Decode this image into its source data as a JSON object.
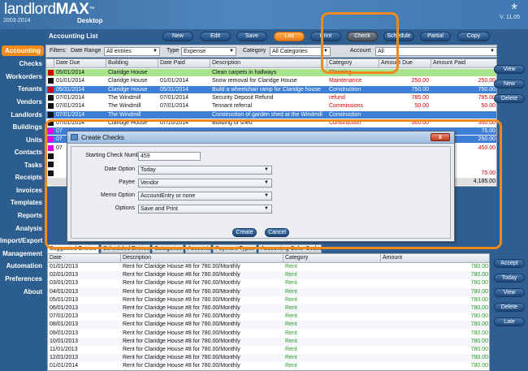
{
  "app": {
    "logo_main": "landlord",
    "logo_bold": "MAX",
    "logo_tm": "™",
    "logo_sub": "2003-2014",
    "logo_desktop": "Desktop",
    "version": "V. 11.05",
    "asterisk": "*"
  },
  "sidebar": {
    "items": [
      {
        "label": "Accounting"
      },
      {
        "label": "Checks"
      },
      {
        "label": "Workorders"
      },
      {
        "label": "Tenants"
      },
      {
        "label": "Vendors"
      },
      {
        "label": "Landlords"
      },
      {
        "label": "Buildings"
      },
      {
        "label": "Units"
      },
      {
        "label": "Contacts"
      },
      {
        "label": "Tasks"
      },
      {
        "label": "Receipts"
      },
      {
        "label": "Invoices"
      },
      {
        "label": "Templates"
      },
      {
        "label": "Reports"
      },
      {
        "label": "Analysis"
      },
      {
        "label": "Import/Export"
      },
      {
        "label": "Management"
      },
      {
        "label": "Automation"
      },
      {
        "label": "Preferences"
      },
      {
        "label": "About"
      }
    ]
  },
  "toolbar": {
    "section_title": "Accounting List",
    "buttons": [
      {
        "label": "New"
      },
      {
        "label": "Edit"
      },
      {
        "label": "Save"
      },
      {
        "label": "List"
      },
      {
        "label": "Print"
      },
      {
        "label": "Check"
      },
      {
        "label": "Schedule"
      },
      {
        "label": "Partial"
      },
      {
        "label": "Copy"
      }
    ]
  },
  "filters": {
    "filters_label": "Filters:",
    "date_range_label": "Date Range",
    "date_range_value": "All entries",
    "type_label": "Type",
    "type_value": "Expense",
    "category_label": "Category",
    "category_value": "All Categories",
    "account_label": "Account",
    "account_value": "All"
  },
  "table": {
    "headers": [
      "Date Due",
      "Building",
      "Date Paid",
      "Description",
      "Category",
      "Amount Due",
      "Amount Paid"
    ],
    "rows": [
      {
        "due": "05/01/2014",
        "building": "Claridge House",
        "paid": "",
        "desc": "Clean carpets in hallways",
        "cat": "Cleaning",
        "amt_due": "",
        "amt_paid": "",
        "swatch": "#d40000",
        "bg": "#a9e48d",
        "cat_color": "#d40000"
      },
      {
        "due": "01/01/2014",
        "building": "Claridge House",
        "paid": "01/01/2014",
        "desc": "Snow removal for Claridge House",
        "cat": "Maintenance",
        "amt_due": "250.00",
        "amt_paid": "250.00",
        "swatch": "#111111",
        "bg": "#ffffff",
        "cat_color": "#d40000"
      },
      {
        "due": "05/31/2014",
        "building": "Claridge House",
        "paid": "05/31/2014",
        "desc": "Build a wheelchair ramp for Claridge house",
        "cat": "Construction",
        "amt_due": "750.00",
        "amt_paid": "750.00",
        "swatch": "#d40000",
        "bg": "#3d7fd6",
        "cat_color": "#ffffff",
        "selected": true
      },
      {
        "due": "07/01/2014",
        "building": "The Windmill",
        "paid": "07/01/2014",
        "desc": "Security Deposit Refund",
        "cat": "refund",
        "amt_due": "785.00",
        "amt_paid": "785.00",
        "swatch": "#111111",
        "bg": "#ffffff",
        "cat_color": "#d40000"
      },
      {
        "due": "07/01/2014",
        "building": "The Windmill",
        "paid": "07/01/2014",
        "desc": "Tennant referral",
        "cat": "Commissions",
        "amt_due": "50.00",
        "amt_paid": "50.00",
        "swatch": "#111111",
        "bg": "#ffffff",
        "cat_color": "#d40000"
      },
      {
        "due": "07/01/2014",
        "building": "The Windmill",
        "paid": "",
        "desc": "Construction of garden shed at the Windmill",
        "cat": "Construction",
        "amt_due": "",
        "amt_paid": "",
        "swatch": "#111111",
        "bg": "#3d7fd6",
        "cat_color": "#ffffff",
        "selected": true
      },
      {
        "due": "07/01/2014",
        "building": "Claridge House",
        "paid": "07/10/2014",
        "desc": "Building of shed",
        "cat": "Construction",
        "amt_due": "500.00",
        "amt_paid": "500.00",
        "swatch": "#111111",
        "bg": "#ffffff",
        "cat_color": "#d40000"
      },
      {
        "due": "07",
        "building": "",
        "paid": "",
        "desc": "",
        "cat": "",
        "amt_due": "",
        "amt_paid": "75.00",
        "swatch": "#e000e0",
        "bg": "#3d7fd6",
        "cat_color": "#ffffff",
        "selected": true
      },
      {
        "due": "07",
        "building": "",
        "paid": "",
        "desc": "",
        "cat": "",
        "amt_due": "",
        "amt_paid": "250.00",
        "swatch": "#e000e0",
        "bg": "#3d7fd6",
        "cat_color": "#ffffff",
        "selected": true
      },
      {
        "due": "07",
        "building": "",
        "paid": "",
        "desc": "",
        "cat": "",
        "amt_due": "",
        "amt_paid": "450.00",
        "swatch": "#e000e0",
        "bg": "#ffffff",
        "cat_color": "#d40000"
      },
      {
        "due": "",
        "building": "",
        "paid": "",
        "desc": "",
        "cat": "",
        "amt_due": "",
        "amt_paid": "",
        "swatch": "#111111",
        "bg": "#ffffff",
        "cat_color": "#d40000"
      },
      {
        "due": "",
        "building": "",
        "paid": "",
        "desc": "",
        "cat": "",
        "amt_due": "",
        "amt_paid": "",
        "swatch": "#111111",
        "bg": "#ffffff",
        "cat_color": "#d40000"
      },
      {
        "due": "",
        "building": "",
        "paid": "",
        "desc": "",
        "cat": "",
        "amt_due": "",
        "amt_paid": "75.00",
        "swatch": "#111111",
        "bg": "#ffffff",
        "cat_color": "#d40000"
      },
      {
        "due": "",
        "building": "",
        "paid": "",
        "desc": "",
        "cat": "",
        "amt_due": "",
        "amt_paid": "4,185.00",
        "swatch": "",
        "bg": "#e0e0e0",
        "cat_color": "#111111",
        "total": true
      }
    ]
  },
  "right_buttons_top": [
    {
      "label": "View"
    },
    {
      "label": "New"
    },
    {
      "label": "Delete"
    }
  ],
  "right_buttons_bottom": [
    {
      "label": "Accept"
    },
    {
      "label": "Today"
    },
    {
      "label": "View"
    },
    {
      "label": "Delete"
    },
    {
      "label": "Late"
    }
  ],
  "bottom_tabs": [
    {
      "label": "Suggested Entries"
    },
    {
      "label": "Scheduled Entries"
    },
    {
      "label": "Categories"
    },
    {
      "label": "Accounts"
    },
    {
      "label": "Payment Types"
    },
    {
      "label": "Accounting Color Codes"
    }
  ],
  "bottom_table": {
    "headers": [
      "Date",
      "Description",
      "Category",
      "Amount"
    ],
    "rows": [
      {
        "date": "01/01/2013",
        "desc": "Rent for Claridge House #8 for 780.00/Monthly",
        "cat": "Rent",
        "amt": "780.00"
      },
      {
        "date": "02/01/2013",
        "desc": "Rent for Claridge House #8 for 780.00/Monthly",
        "cat": "Rent",
        "amt": "780.00"
      },
      {
        "date": "03/01/2013",
        "desc": "Rent for Claridge House #8 for 780.00/Monthly",
        "cat": "Rent",
        "amt": "780.00"
      },
      {
        "date": "04/01/2013",
        "desc": "Rent for Claridge House #8 for 780.00/Monthly",
        "cat": "Rent",
        "amt": "780.00"
      },
      {
        "date": "05/01/2013",
        "desc": "Rent for Claridge House #8 for 780.00/Monthly",
        "cat": "Rent",
        "amt": "780.00"
      },
      {
        "date": "06/01/2013",
        "desc": "Rent for Claridge House #8 for 780.00/Monthly",
        "cat": "Rent",
        "amt": "780.00"
      },
      {
        "date": "07/01/2013",
        "desc": "Rent for Claridge House #8 for 780.00/Monthly",
        "cat": "Rent",
        "amt": "780.00"
      },
      {
        "date": "08/01/2013",
        "desc": "Rent for Claridge House #8 for 780.00/Monthly",
        "cat": "Rent",
        "amt": "780.00"
      },
      {
        "date": "09/01/2013",
        "desc": "Rent for Claridge House #8 for 780.00/Monthly",
        "cat": "Rent",
        "amt": "780.00"
      },
      {
        "date": "10/01/2013",
        "desc": "Rent for Claridge House #8 for 780.00/Monthly",
        "cat": "Rent",
        "amt": "780.00"
      },
      {
        "date": "11/01/2013",
        "desc": "Rent for Claridge House #8 for 780.00/Monthly",
        "cat": "Rent",
        "amt": "780.00"
      },
      {
        "date": "12/01/2013",
        "desc": "Rent for Claridge House #8 for 780.00/Monthly",
        "cat": "Rent",
        "amt": "780.00"
      },
      {
        "date": "01/01/2014",
        "desc": "Rent for Claridge House #8 for 780.00/Monthly",
        "cat": "Rent",
        "amt": "780.00"
      }
    ]
  },
  "dialog": {
    "title": "Create Checks",
    "close_label": "x",
    "starting_check_label": "Starting Check Number",
    "starting_check_value": "459",
    "date_option_label": "Date Option",
    "date_option_value": "Today",
    "payee_label": "Payee",
    "payee_value": "Vendor",
    "memo_option_label": "Memo Option",
    "memo_option_value": "AccountEntry or none",
    "options_label": "Options",
    "options_value": "Save and Print",
    "create_label": "Create",
    "cancel_label": "Cancel"
  },
  "colors": {
    "accent_orange": "#f08a1c",
    "header_blue": "#3a6fa3",
    "rent_green": "#2a9a2a",
    "expense_red": "#d40000"
  }
}
